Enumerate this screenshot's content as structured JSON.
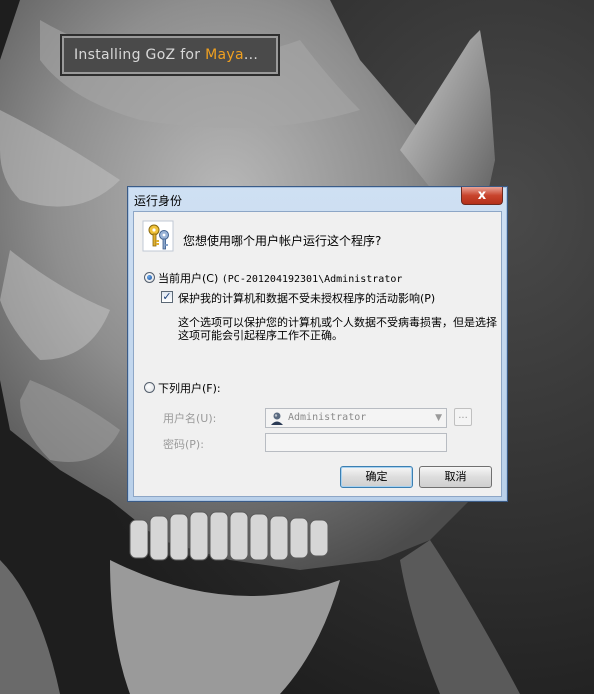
{
  "splash": {
    "prefix": "Installing GoZ for ",
    "app": "Maya",
    "suffix": "..."
  },
  "dialog": {
    "title": "运行身份",
    "close_label": "x",
    "question": "您想使用哪个用户帐户运行这个程序?",
    "current_user": {
      "label": "当前用户(C)",
      "account": "(PC-201204192301\\Administrator",
      "selected": true
    },
    "protect": {
      "label": "保护我的计算机和数据不受未授权程序的活动影响(P)",
      "checked": true
    },
    "info": "这个选项可以保护您的计算机或个人数据不受病毒损害，但是选择这项可能会引起程序工作不正确。",
    "other_user": {
      "label": "下列用户(F):",
      "selected": false
    },
    "username_label": "用户名(U):",
    "username_value": "Administrator",
    "password_label": "密码(P):",
    "password_value": "",
    "browse_label": "...",
    "ok_label": "确定",
    "cancel_label": "取消"
  },
  "icons": {
    "keys": "keys-icon",
    "user": "user-icon",
    "dropdown": "chevron-down-icon"
  },
  "colors": {
    "splash_accent": "#f0a020",
    "title_bar": "#cfe0f3",
    "close_button": "#c8442d"
  }
}
